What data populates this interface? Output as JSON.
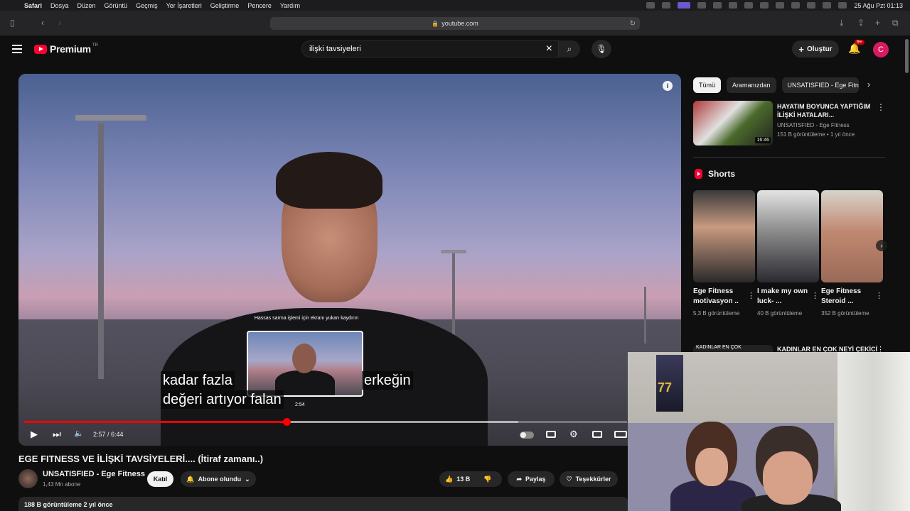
{
  "menubar": {
    "app": "Safari",
    "items": [
      "Dosya",
      "Düzen",
      "Görüntü",
      "Geçmiş",
      "Yer İşaretleri",
      "Geliştirme",
      "Pencere",
      "Yardım"
    ],
    "datetime": "25 Ağu Pzt  01:13"
  },
  "browser": {
    "url": "youtube.com"
  },
  "header": {
    "logo_text": "Premium",
    "logo_region": "TR",
    "search_value": "ilişki tavsiyeleri",
    "create_label": "Oluştur",
    "notification_badge": "9+",
    "avatar_letter": "C"
  },
  "player": {
    "hint": "Hassas sarma işlemi için ekranı yukarı kaydırın",
    "preview_time": "2:54",
    "caption_line1_a": "kadar fazla",
    "caption_line1_b": "erkeğin",
    "caption_line2": "değeri artıyor falan",
    "time": "2:57 / 6:44",
    "played_fraction": 0.435,
    "loaded_fraction": 0.82
  },
  "video": {
    "title": "EGE FITNESS VE İLİŞKİ TAVSİYELERİ.... (İtiraf zamanı..)",
    "channel": "UNSATISFIED - Ege Fitness",
    "subscribers": "1,43 Mn abone",
    "join": "Katıl",
    "subscribed": "Abone olundu",
    "likes": "13 B",
    "share": "Paylaş",
    "thanks": "Teşekkürler",
    "views": "188 B görüntüleme  2 yıl önce"
  },
  "sidebar": {
    "chips": [
      "Tümü",
      "Aramanızdan",
      "UNSATISFIED - Ege Fitness"
    ],
    "rec": {
      "title": "HAYATIM BOYUNCA YAPTIĞIM İLİŞKİ HATALARI...",
      "channel": "UNSATISFIED - Ege Fitness",
      "meta": "151 B görüntüleme • 1 yıl önce",
      "duration": "16:46"
    },
    "shorts_title": "Shorts",
    "shorts": [
      {
        "title": "Ege Fitness motivasyon ..",
        "views": "5,3 B görüntüleme"
      },
      {
        "title": "I make my own luck- ...",
        "views": "40 B görüntüleme"
      },
      {
        "title": "Ege Fitness Steroid ...",
        "views": "352 B görüntüleme"
      }
    ],
    "rec2": {
      "title": "KADINLAR EN ÇOK NEYİ ÇEKİCİ",
      "thumb_text": "KADINLAR  EN ÇOK"
    }
  },
  "colors": {
    "brand_red": "#ff0033",
    "background": "#0f0f0f"
  }
}
